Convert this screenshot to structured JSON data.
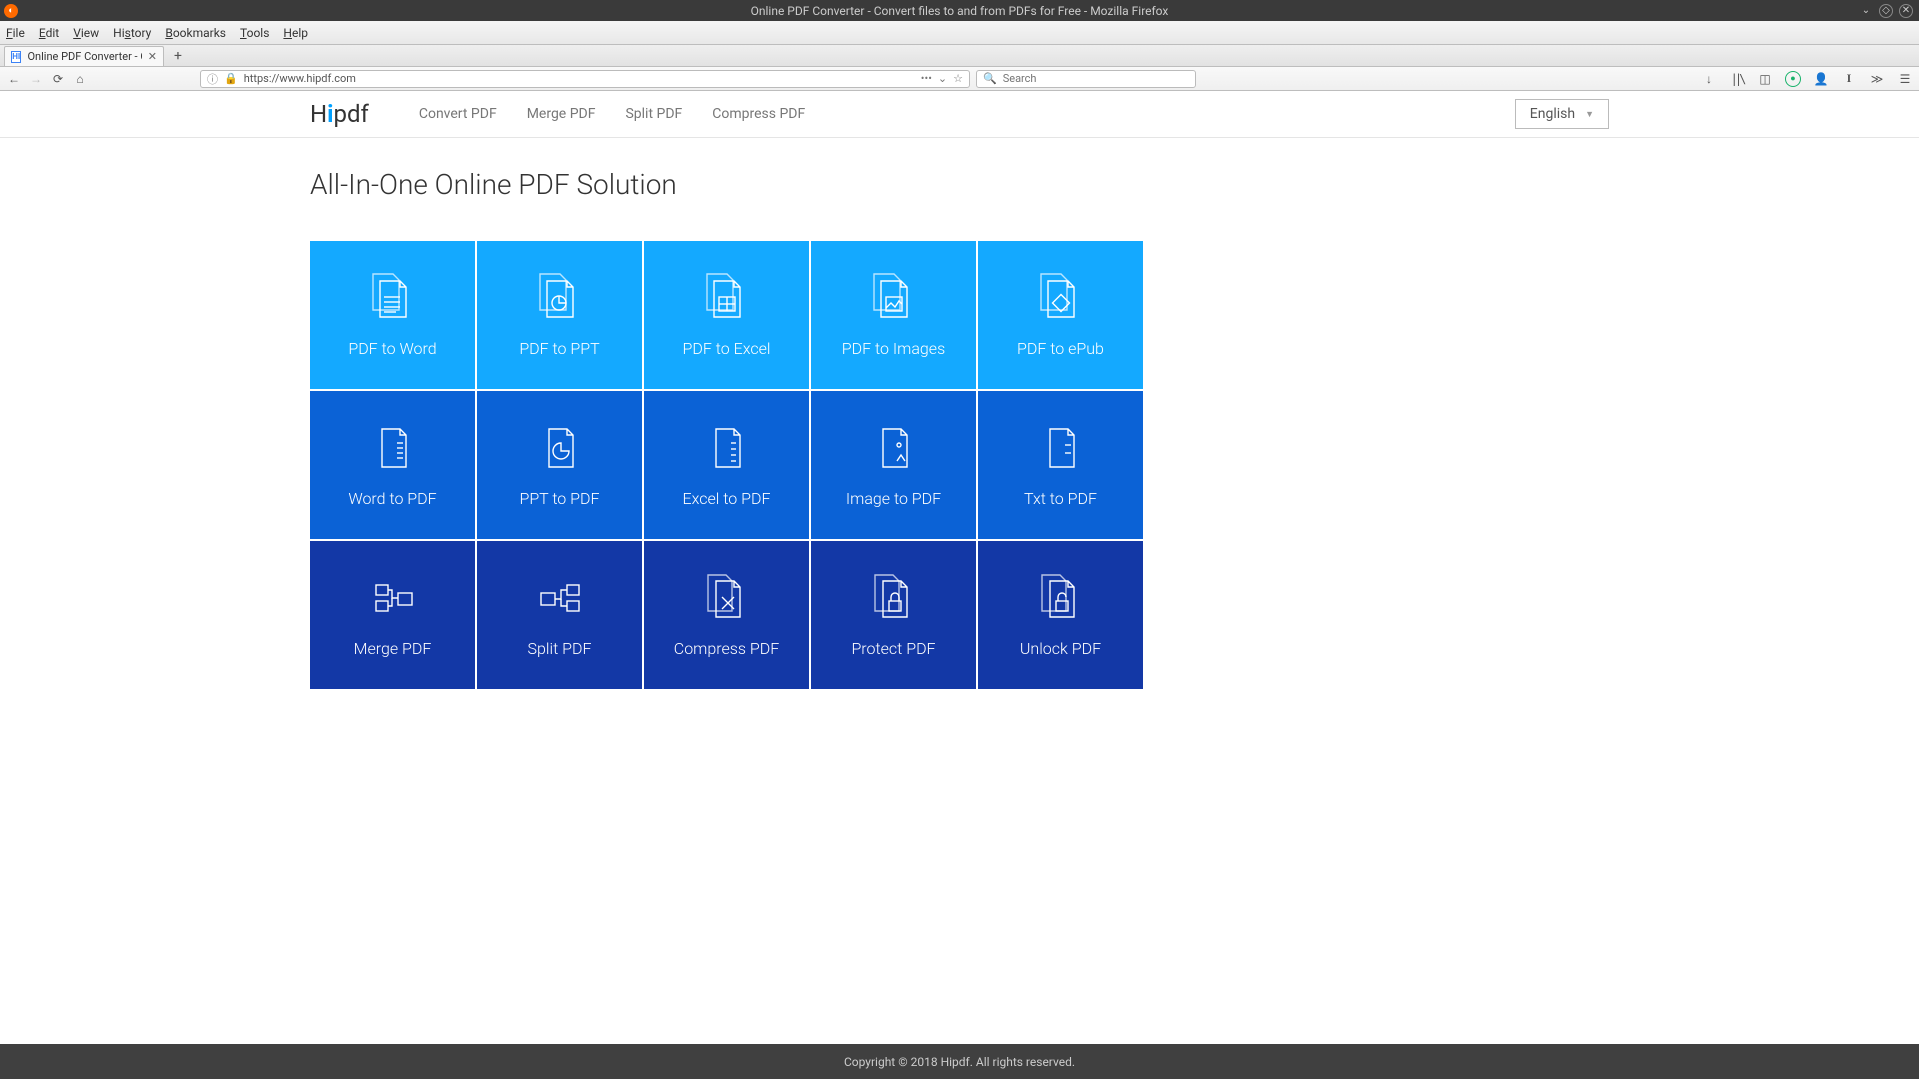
{
  "window": {
    "title": "Online PDF Converter - Convert files to and from PDFs for Free - Mozilla Firefox"
  },
  "menubar": {
    "items": [
      "File",
      "Edit",
      "View",
      "History",
      "Bookmarks",
      "Tools",
      "Help"
    ]
  },
  "tab": {
    "title": "Online PDF Converter - Co..."
  },
  "url": "https://www.hipdf.com",
  "search": {
    "placeholder": "Search"
  },
  "site": {
    "logo": "Hipdf",
    "nav": [
      "Convert PDF",
      "Merge PDF",
      "Split PDF",
      "Compress PDF"
    ],
    "language": "English"
  },
  "heading": "All-In-One Online PDF Solution",
  "tiles": {
    "row1": [
      "PDF to Word",
      "PDF to PPT",
      "PDF to Excel",
      "PDF to Images",
      "PDF to ePub"
    ],
    "row2": [
      "Word to PDF",
      "PPT to PDF",
      "Excel to PDF",
      "Image to PDF",
      "Txt to PDF"
    ],
    "row3": [
      "Merge PDF",
      "Split PDF",
      "Compress PDF",
      "Protect PDF",
      "Unlock PDF"
    ]
  },
  "footer": "Copyright © 2018 Hipdf. All rights reserved."
}
